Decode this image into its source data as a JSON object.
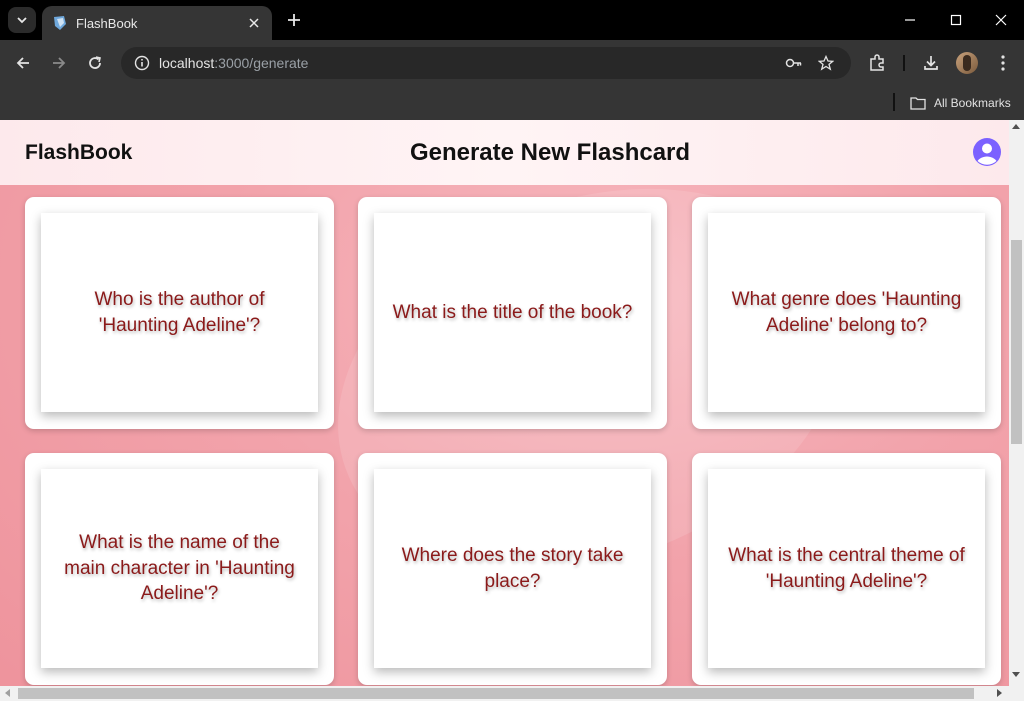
{
  "browser": {
    "tab_title": "FlashBook",
    "url_host": "localhost",
    "url_path": ":3000/generate",
    "bookmarks_label": "All Bookmarks"
  },
  "app": {
    "brand": "FlashBook",
    "page_title": "Generate New Flashcard"
  },
  "cards": [
    {
      "text": "Who is the author of 'Haunting Adeline'?"
    },
    {
      "text": "What is the title of the book?"
    },
    {
      "text": "What genre does 'Haunting Adeline' belong to?"
    },
    {
      "text": "What is the name of the main character in 'Haunting Adeline'?"
    },
    {
      "text": "Where does the story take place?"
    },
    {
      "text": "What is the central theme of 'Haunting Adeline'?"
    }
  ]
}
